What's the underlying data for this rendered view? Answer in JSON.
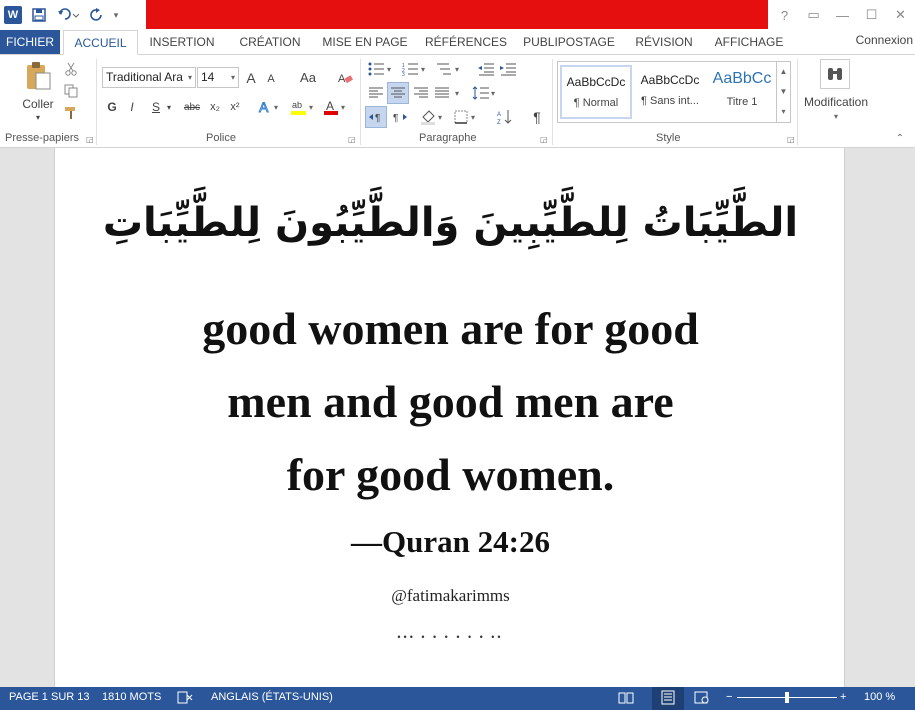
{
  "qat": {
    "word_icon": "W",
    "save_icon": "save-icon",
    "undo_icon": "undo-icon",
    "redo_icon": "redo-icon"
  },
  "window": {
    "help": "?",
    "restore_ribbon": "▭",
    "minimize": "—",
    "maximize": "☐",
    "close": "✕",
    "connexion": "Connexion"
  },
  "tabs": [
    {
      "label": "FICHIER"
    },
    {
      "label": "ACCUEIL"
    },
    {
      "label": "INSERTION"
    },
    {
      "label": "CRÉATION"
    },
    {
      "label": "MISE EN PAGE"
    },
    {
      "label": "RÉFÉRENCES"
    },
    {
      "label": "PUBLIPOSTAGE"
    },
    {
      "label": "RÉVISION"
    },
    {
      "label": "AFFICHAGE"
    }
  ],
  "ribbon": {
    "clipboard": {
      "paste_label": "Coller",
      "group_label": "Presse-papiers"
    },
    "font": {
      "family": "Traditional Ara",
      "size": "14",
      "grow": "A",
      "shrink": "A",
      "case": "Aa",
      "bold": "G",
      "italic": "I",
      "underline": "S",
      "strike": "abc",
      "subscript": "x₂",
      "superscript": "x²",
      "group_label": "Police"
    },
    "paragraph": {
      "pilcrow": "¶",
      "group_label": "Paragraphe"
    },
    "styles": {
      "items": [
        {
          "sample": "AaBbCcDc",
          "name": "¶ Normal"
        },
        {
          "sample": "AaBbCcDc",
          "name": "¶ Sans int..."
        },
        {
          "sample": "AaBbCc",
          "name": "Titre 1"
        }
      ],
      "group_label": "Style"
    },
    "editing": {
      "label": "Modification"
    }
  },
  "document": {
    "arabic": "الطَّيِّبَاتُ لِلطَّيِّبِينَ وَالطَّيِّبُونَ لِلطَّيِّبَاتِ",
    "verse_lines": [
      "good women are for good",
      "men and good men are",
      "for good women."
    ],
    "citation": "—Quran 24:26",
    "handle": "@fatimakarimms",
    "dots": "•••  •  •    •    •  •  •  ••"
  },
  "status": {
    "page": "PAGE 1 SUR 13",
    "words": "1810 MOTS",
    "language": "ANGLAIS (ÉTATS-UNIS)",
    "zoom": "100 %",
    "zoom_minus": "−",
    "zoom_plus": "+"
  },
  "colors": {
    "accent": "#2b579a",
    "title_band": "#e50f0f"
  }
}
